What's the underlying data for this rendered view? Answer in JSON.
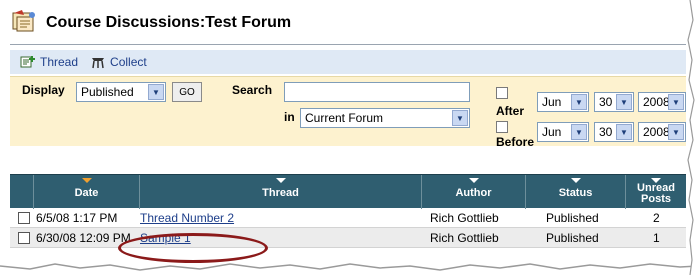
{
  "header": {
    "title": "Course Discussions:Test Forum",
    "icon": "discussion-board-icon"
  },
  "actions": [
    {
      "label": "Thread",
      "icon": "add-thread-icon"
    },
    {
      "label": "Collect",
      "icon": "collect-icon"
    }
  ],
  "filter": {
    "display_label": "Display",
    "display_value": "Published",
    "go_label": "GO",
    "search_label": "Search",
    "search_value": "",
    "in_label": "in",
    "scope_value": "Current Forum",
    "after_label": "After",
    "before_label": "Before",
    "after_date": {
      "month": "Jun",
      "day": "30",
      "year": "2008"
    },
    "before_date": {
      "month": "Jun",
      "day": "30",
      "year": "2008"
    }
  },
  "table": {
    "columns": [
      "Date",
      "Thread",
      "Author",
      "Status",
      "Unread Posts"
    ],
    "sorted_column": "Date",
    "rows": [
      {
        "date": "6/5/08 1:17 PM",
        "thread": "Thread Number 2",
        "author": "Rich Gottlieb",
        "status": "Published",
        "unread": "2"
      },
      {
        "date": "6/30/08 12:09 PM",
        "thread": "Sample 1",
        "author": "Rich Gottlieb",
        "status": "Published",
        "unread": "1"
      }
    ]
  },
  "colors": {
    "header_bar": "#2f5e70",
    "filter_bg": "#fdf2cf",
    "action_bg": "#dfe9f5",
    "link": "#1e3f8a",
    "highlight_oval": "#8b1a1a"
  }
}
